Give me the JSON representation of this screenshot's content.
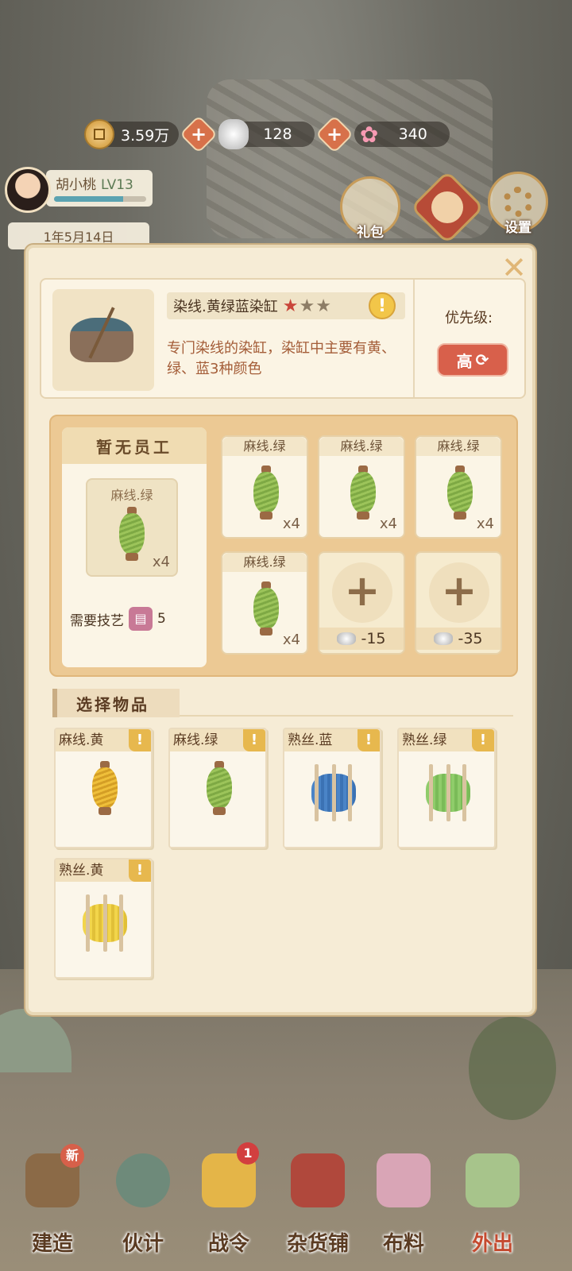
{
  "resources": {
    "coins": "3.59万",
    "silver": "128",
    "flowers": "340"
  },
  "player": {
    "name": "胡小桃",
    "level": "LV13",
    "xp_fraction": 0.75,
    "date": "1年5月14日"
  },
  "top_icons": {
    "gift_label": "礼包",
    "settings_label": "设置"
  },
  "building": {
    "title": "染线.黄绿蓝染缸",
    "stars_on": "★",
    "stars_off": "★★",
    "star_rating": 1,
    "star_max": 3,
    "description": "专门染线的染缸，染缸中主要有黄、绿、蓝3种颜色",
    "priority_label": "优先级:",
    "priority_value": "高"
  },
  "staff": {
    "header": "暂无员工",
    "item_label": "麻线.绿",
    "item_qty": "x4",
    "skill_label": "需要技艺",
    "skill_value": "5"
  },
  "slots": [
    {
      "label": "麻线.绿",
      "qty": "x4"
    },
    {
      "label": "麻线.绿",
      "qty": "x4"
    },
    {
      "label": "麻线.绿",
      "qty": "x4"
    },
    {
      "label": "麻线.绿",
      "qty": "x4"
    }
  ],
  "empty_slots": [
    {
      "cost": "-15"
    },
    {
      "cost": "-35"
    }
  ],
  "select_title": "选择物品",
  "items": [
    {
      "label": "麻线.黄",
      "type": "spool-yellow"
    },
    {
      "label": "麻线.绿",
      "type": "spool-green"
    },
    {
      "label": "熟丝.蓝",
      "type": "skein-blue"
    },
    {
      "label": "熟丝.绿",
      "type": "skein-green"
    },
    {
      "label": "熟丝.黄",
      "type": "skein-yellow"
    }
  ],
  "nav": {
    "build": "建造",
    "build_badge": "新",
    "staff": "伙计",
    "battle_pass": "战令",
    "battle_pass_badge": "1",
    "shop": "杂货铺",
    "fabric": "布料",
    "outing": "外出"
  },
  "colors": {
    "panel_bg": "#f6ecd6",
    "accent_red": "#d8604b",
    "work_area": "#ecc994"
  }
}
